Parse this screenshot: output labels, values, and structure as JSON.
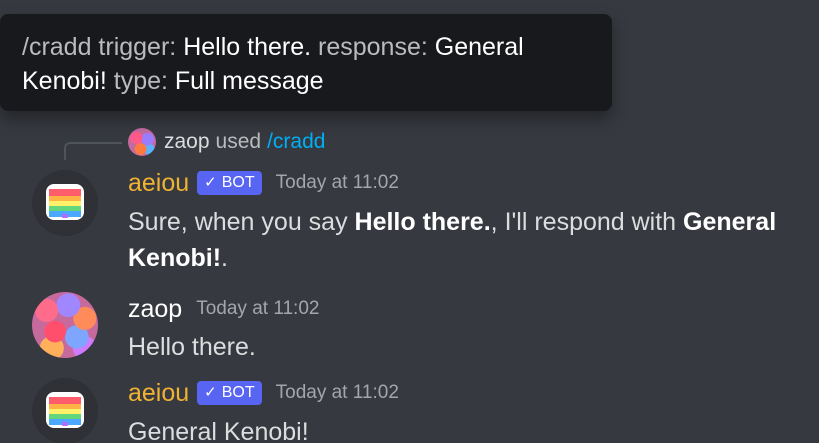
{
  "tooltip": {
    "k1": "/cradd trigger:",
    "v1": "Hello there.",
    "k2": "response:",
    "v2": "General Kenobi!",
    "k3": "type:",
    "v3": "Full message"
  },
  "reply": {
    "username": "zaop",
    "used": "used",
    "command": "/cradd"
  },
  "messages": [
    {
      "author": "aeiou",
      "badge_check": "✓",
      "badge": "BOT",
      "timestamp": "Today at 11:02",
      "text_1": "Sure, when you say ",
      "bold_1": "Hello there.",
      "text_2": ", I'll respond with ",
      "bold_2": "General Kenobi!",
      "text_3": "."
    },
    {
      "author": "zaop",
      "timestamp": "Today at 11:02",
      "text": "Hello there."
    },
    {
      "author": "aeiou",
      "badge_check": "✓",
      "badge": "BOT",
      "timestamp": "Today at 11:02",
      "text": "General Kenobi!"
    }
  ],
  "colors": {
    "background": "#36393f",
    "tooltip_bg": "#18191c",
    "bot_name": "#f0b232",
    "bot_tag": "#5865f2",
    "command_link": "#00aff4"
  }
}
